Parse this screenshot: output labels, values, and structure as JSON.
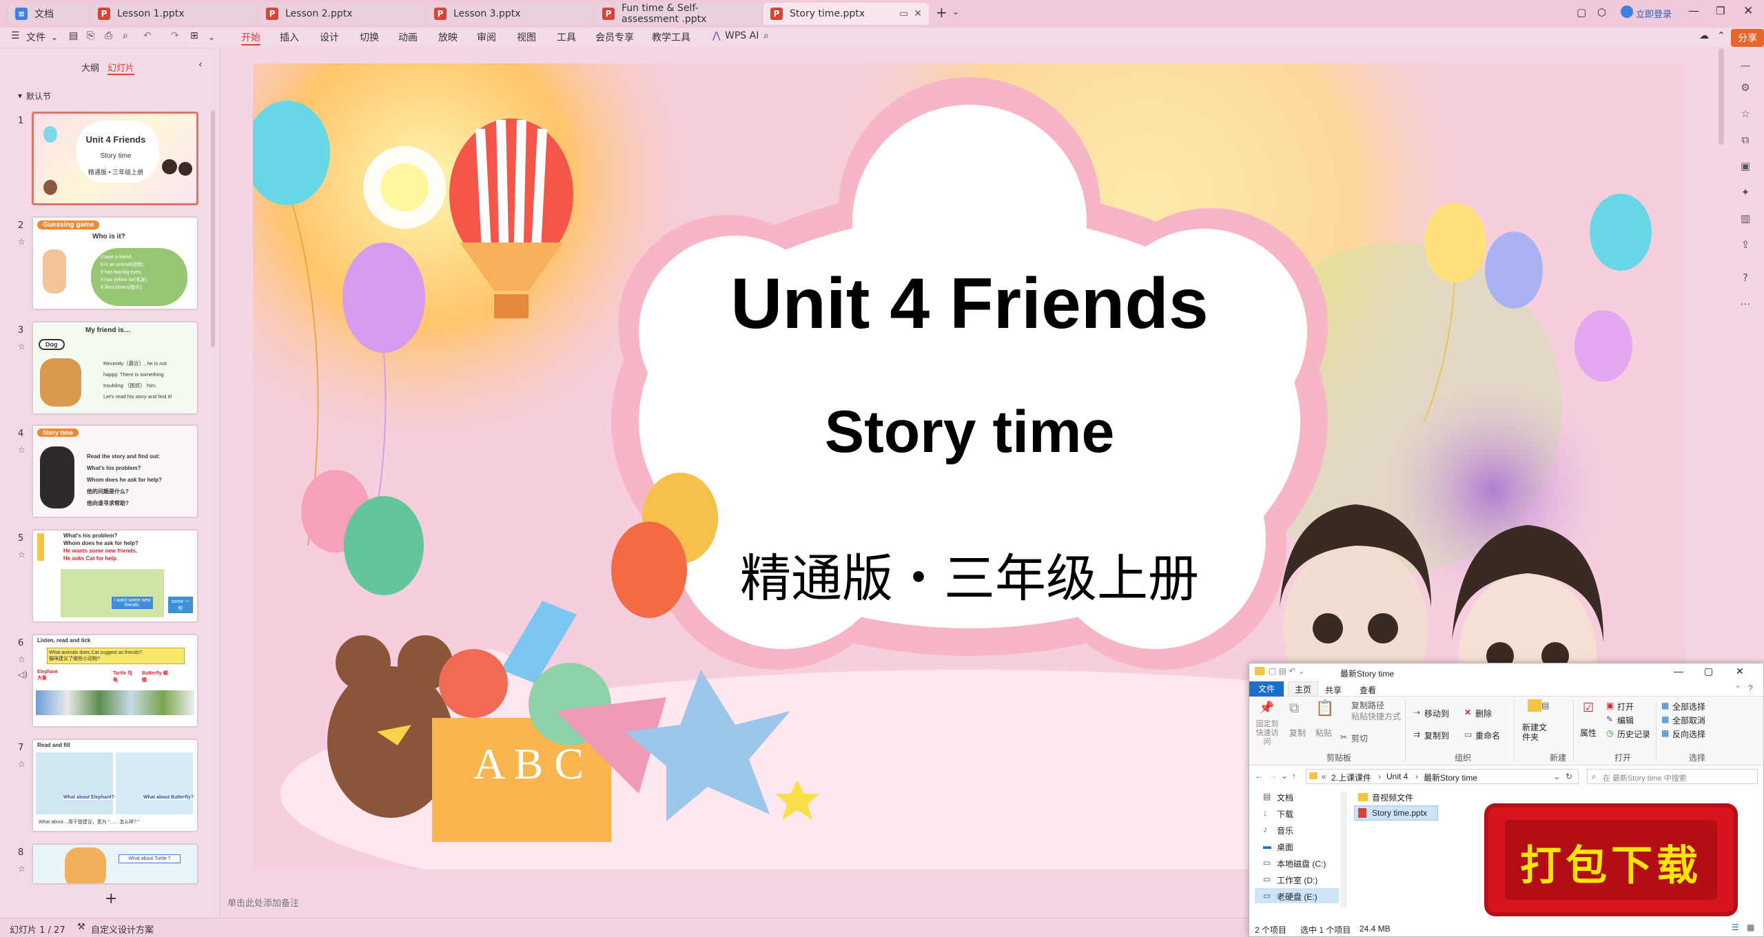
{
  "tabs": [
    {
      "label": "文档",
      "icon": "doc"
    },
    {
      "label": "Lesson 1.pptx",
      "icon": "P"
    },
    {
      "label": "Lesson 2.pptx",
      "icon": "P"
    },
    {
      "label": "Lesson 3.pptx",
      "icon": "P"
    },
    {
      "label": "Fun time & Self-assessment .pptx",
      "icon": "P"
    },
    {
      "label": "Story time.pptx",
      "icon": "P"
    }
  ],
  "titlebar": {
    "login": "立即登录",
    "new_tab": "+"
  },
  "ribbon": {
    "file": "文件",
    "menus": [
      "开始",
      "插入",
      "设计",
      "切换",
      "动画",
      "放映",
      "审阅",
      "视图",
      "工具",
      "会员专享",
      "教学工具"
    ],
    "wps_ai": "WPS AI",
    "share": "分享"
  },
  "left_panel": {
    "tab_outline": "大纲",
    "tab_slides": "幻灯片",
    "section": "默认节",
    "add": "+"
  },
  "thumbnails": [
    {
      "num": "1",
      "title": "Unit 4  Friends",
      "sub": "Story time",
      "line": "精通版 • 三年级上册"
    },
    {
      "num": "2",
      "tag": "Guessing game",
      "title": "Who is it?",
      "lines": [
        "I have a friend.",
        "It is an animal(动物).",
        "It has two big eyes.",
        "It has yellow fur(毛发).",
        "It likes bones(骨头)."
      ]
    },
    {
      "num": "3",
      "title": "My friend is…",
      "tag": "Dog",
      "lines": [
        "Recently（最近）, he is not",
        "happy. There is something",
        "troubling （困扰） him.",
        "Let's read his story and find it!"
      ]
    },
    {
      "num": "4",
      "tag": "Story time",
      "lines": [
        "Read the story and find out:",
        "What's his problem?",
        "Whom does he ask for help?",
        "他的问题是什么?",
        "他向谁寻求帮助?"
      ]
    },
    {
      "num": "5",
      "lines": [
        "What's his problem?",
        "Whom does he ask for help?",
        "He wants some new friends.",
        "He asks Cat for help."
      ],
      "bubble1": "I want some new friends.",
      "bubble2": "some 一些"
    },
    {
      "num": "6",
      "title": "Listen, read and tick",
      "q1": "What animals does Cat suggest as friends?",
      "q2": "猫咪建议了哪些小动物?",
      "labels": [
        "Elephant 大象",
        "Turtle 乌龟",
        "Butterfly 蝴蝶"
      ]
    },
    {
      "num": "7",
      "title": "Read and fill",
      "labels": [
        "What about Elephant?",
        "What about Butterfly?"
      ],
      "bottom": "What about…用于提建议，意为 “……怎么样? ”"
    },
    {
      "num": "8",
      "label": "What about Turtle ?"
    }
  ],
  "slide": {
    "title": "Unit 4  Friends",
    "subtitle": "Story time",
    "edition": "精通版・三年级上册",
    "crate_text": "A B C"
  },
  "notes_placeholder": "单击此处添加备注",
  "status": {
    "slide_counter": "幻灯片 1 / 27",
    "design": "自定义设计方案"
  },
  "explorer": {
    "title": "最新Story time",
    "ribbon_tabs": [
      "文件",
      "主页",
      "共享",
      "查看"
    ],
    "clipboard": {
      "pin": "固定到快速访问",
      "copy": "复制",
      "paste": "粘贴",
      "copy_path": "复制路径",
      "paste_shortcut": "粘贴快捷方式",
      "cut": "剪切",
      "group": "剪贴板"
    },
    "organize": {
      "move": "移动到",
      "copyto": "复制到",
      "delete": "删除",
      "rename": "重命名",
      "group": "组织"
    },
    "new": {
      "folder": "新建文件夹",
      "group": "新建"
    },
    "open": {
      "props": "属性",
      "open": "打开",
      "edit": "编辑",
      "history": "历史记录",
      "group": "打开"
    },
    "select": {
      "all": "全部选择",
      "none": "全部取消",
      "invert": "反向选择",
      "group": "选择"
    },
    "path": [
      "2.上课课件",
      "Unit 4",
      "最新Story time"
    ],
    "search_placeholder": "在 最新Story time 中搜索",
    "nav": [
      "文档",
      "下载",
      "音乐",
      "桌面",
      "本地磁盘 (C:)",
      "工作室 (D:)",
      "老硬盘 (E:)"
    ],
    "files": [
      "音视频文件",
      "Story time.pptx"
    ],
    "status": {
      "count": "2 个项目",
      "selected": "选中 1 个项目",
      "size": "24.4 MB"
    }
  },
  "download_badge": "打包下载",
  "colors": {
    "accent": "#d9443a",
    "share": "#e8662a",
    "panel": "#f4d9e7"
  }
}
